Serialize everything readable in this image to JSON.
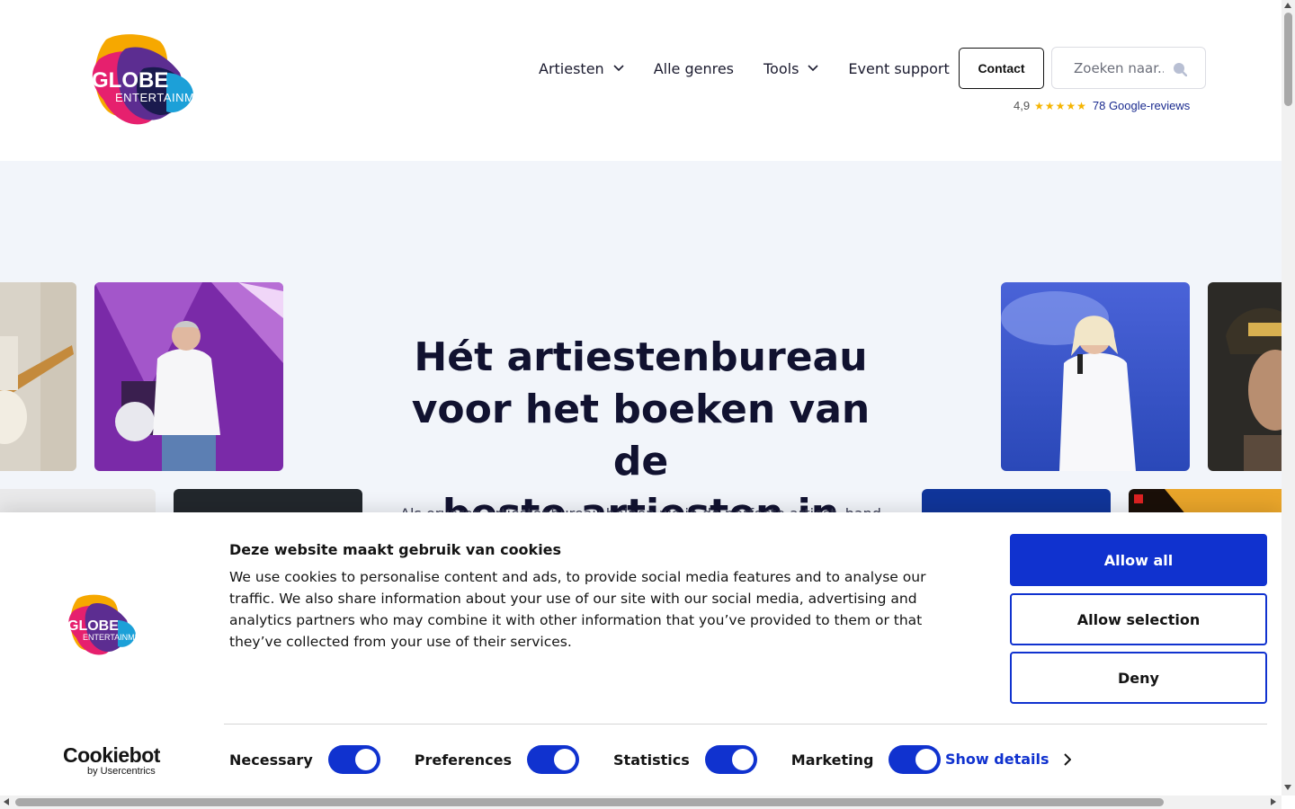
{
  "header": {
    "logo": {
      "line1": "GLOBE",
      "line2": "ENTERTAINMENT"
    },
    "nav": [
      {
        "label": "Artiesten",
        "dropdown": true
      },
      {
        "label": "Alle genres",
        "dropdown": false
      },
      {
        "label": "Tools",
        "dropdown": true
      },
      {
        "label": "Event support",
        "dropdown": false
      }
    ],
    "contact_label": "Contact",
    "search_placeholder": "Zoeken naar..",
    "reviews": {
      "score": "4,9",
      "stars": "★★★★★",
      "link_text": "78 Google-reviews"
    }
  },
  "hero": {
    "title_bold": "Hét artiestenbureau",
    "title_line2": "voor het boeken van de",
    "title_line3": "beste artiesten in België",
    "subtitle_partial": "Als ervaren artiestenbureau helpen we je de perfecte artiest, band"
  },
  "cookie": {
    "title": "Deze website maakt gebruik van cookies",
    "body": "We use cookies to personalise content and ads, to provide social media features and to analyse our traffic. We also share information about your use of our site with our social media, advertising and analytics partners who may combine it with other information that you’ve provided to them or that they’ve collected from your use of their services.",
    "allow_all": "Allow all",
    "allow_selection": "Allow selection",
    "deny": "Deny",
    "toggles": [
      {
        "label": "Necessary",
        "on": true
      },
      {
        "label": "Preferences",
        "on": true
      },
      {
        "label": "Statistics",
        "on": true
      },
      {
        "label": "Marketing",
        "on": true
      }
    ],
    "show_details": "Show details",
    "cookiebot_brand": "Cookiebot",
    "cookiebot_sub": "by Usercentrics"
  },
  "colors": {
    "primary": "#1032cf",
    "hero_bg": "#f2f5fa",
    "text_dark": "#111230"
  }
}
